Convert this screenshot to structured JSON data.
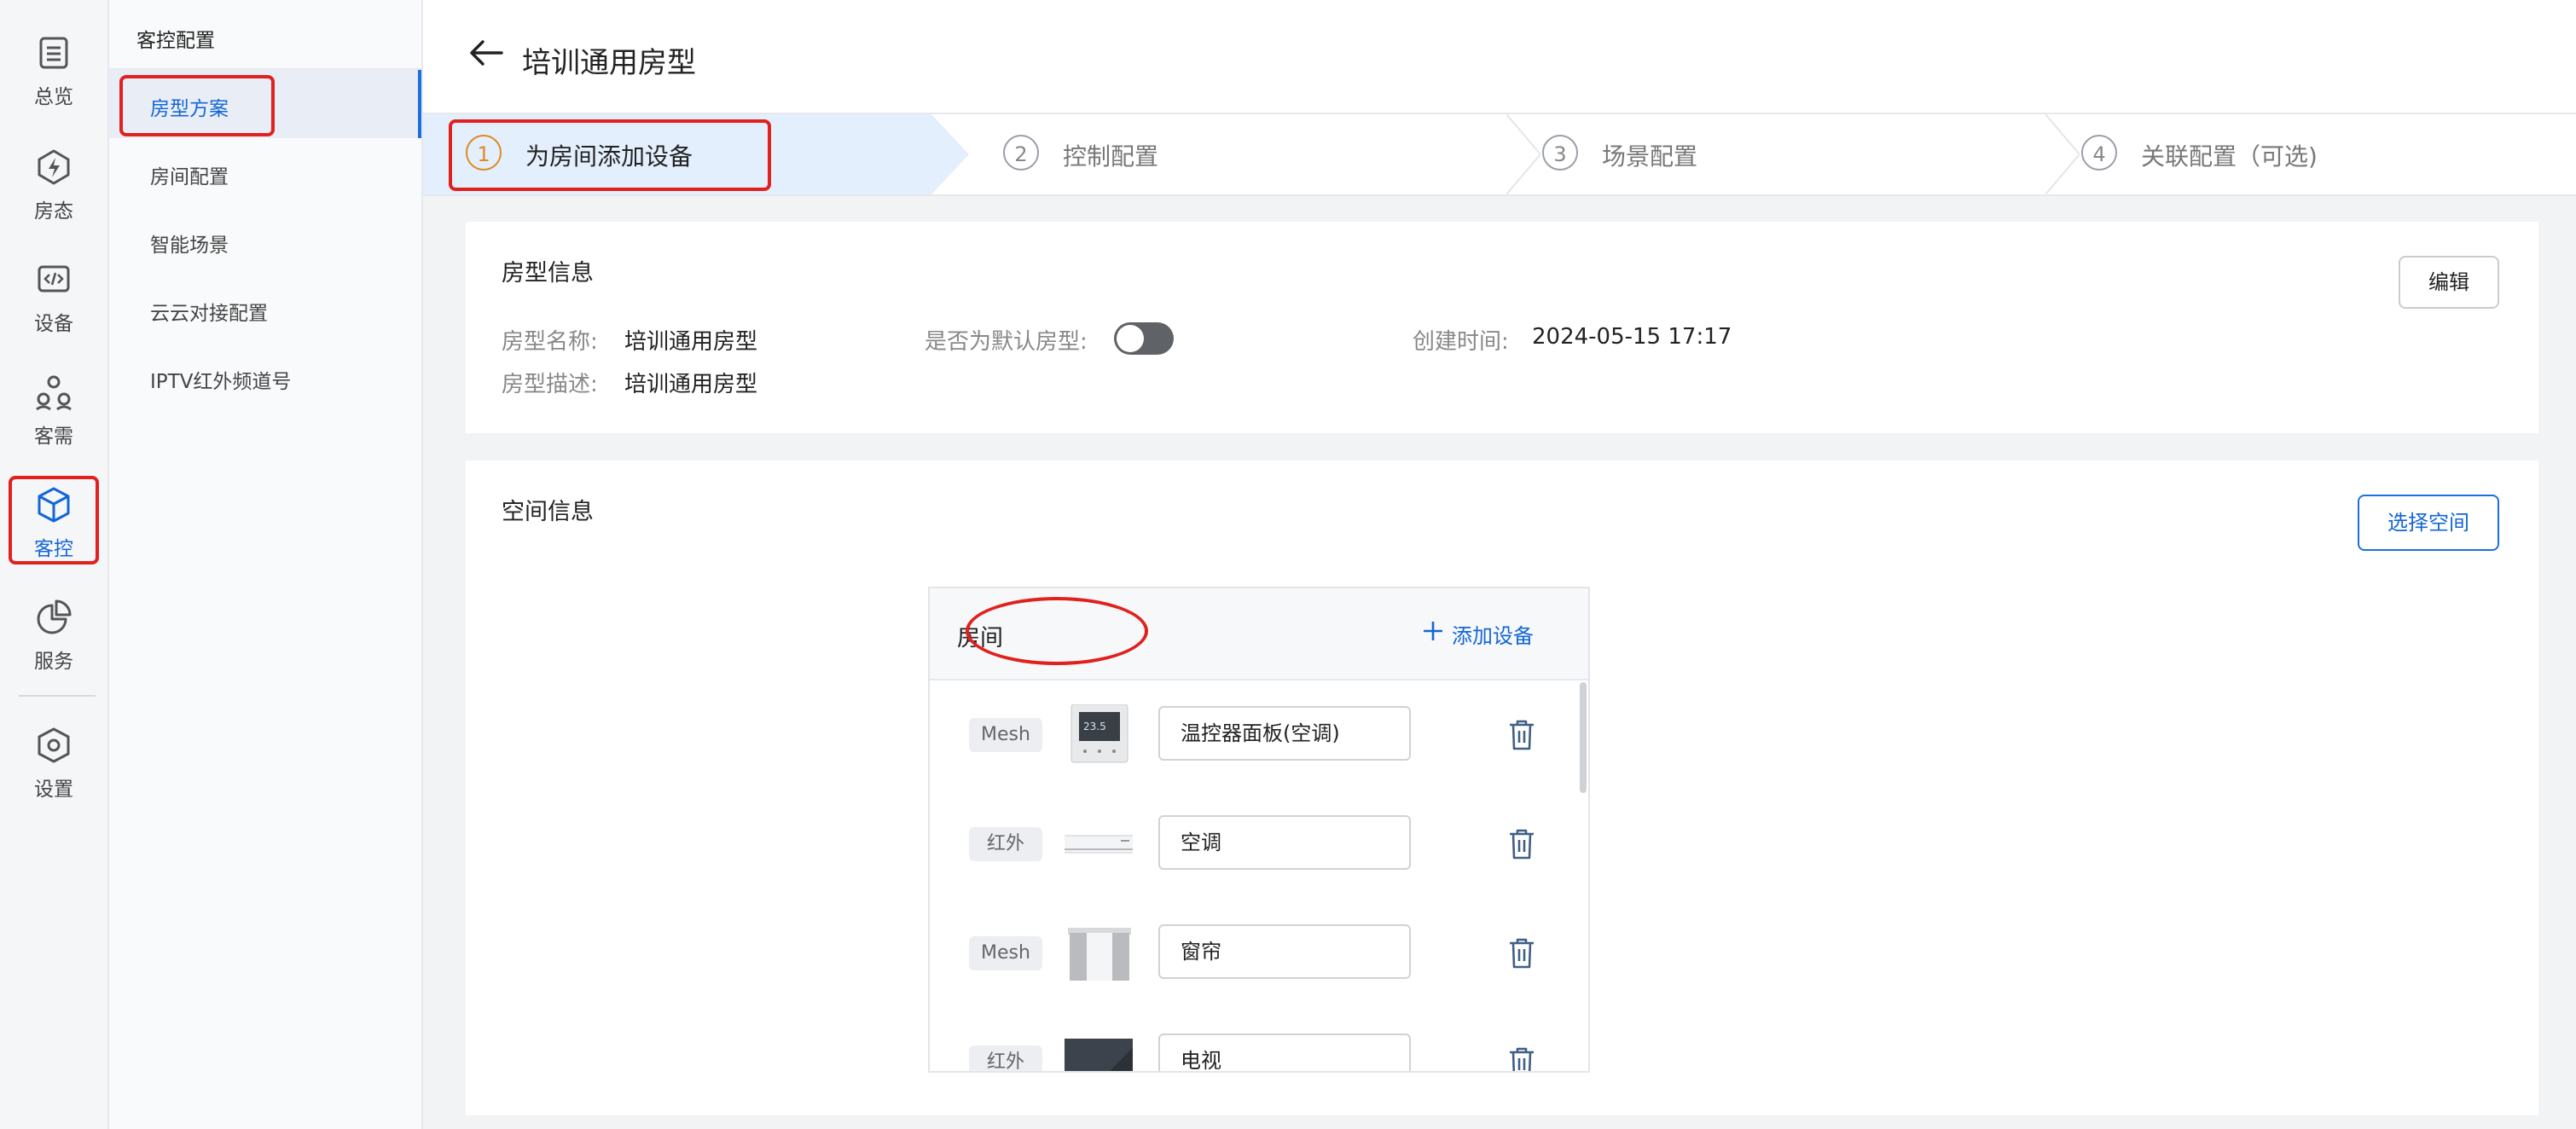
{
  "colors": {
    "accent": "#1366d6",
    "annotation": "#e0211d",
    "step_active": "#e08a1c"
  },
  "rail": {
    "items": [
      {
        "label": "总览",
        "icon": "list-icon"
      },
      {
        "label": "房态",
        "icon": "lightning-icon"
      },
      {
        "label": "设备",
        "icon": "code-icon"
      },
      {
        "label": "客需",
        "icon": "people-icon"
      },
      {
        "label": "客控",
        "icon": "cube-icon"
      },
      {
        "label": "服务",
        "icon": "pie-icon"
      },
      {
        "label": "设置",
        "icon": "settings-icon"
      }
    ],
    "active": "客控"
  },
  "subnav": {
    "title": "客控配置",
    "items": [
      {
        "label": "房型方案"
      },
      {
        "label": "房间配置"
      },
      {
        "label": "智能场景"
      },
      {
        "label": "云云对接配置"
      },
      {
        "label": "IPTV红外频道号"
      }
    ],
    "active": "房型方案"
  },
  "header": {
    "title": "培训通用房型",
    "back_icon": "arrow-left-icon"
  },
  "steps": [
    {
      "num": "1",
      "label": "为房间添加设备",
      "active": true
    },
    {
      "num": "2",
      "label": "控制配置",
      "active": false
    },
    {
      "num": "3",
      "label": "场景配置",
      "active": false
    },
    {
      "num": "4",
      "label": "关联配置（可选)",
      "active": false
    }
  ],
  "room_type_info": {
    "title": "房型信息",
    "edit_button": "编辑",
    "name_label": "房型名称:",
    "name_value": "培训通用房型",
    "default_label": "是否为默认房型:",
    "default_value": "off",
    "created_label": "创建时间:",
    "created_value": "2024-05-15 17:17",
    "desc_label": "房型描述:",
    "desc_value": "培训通用房型"
  },
  "space_info": {
    "title": "空间信息",
    "select_button": "选择空间",
    "room": {
      "name": "房间",
      "add_device": "添加设备",
      "devices": [
        {
          "protocol": "Mesh",
          "name": "温控器面板(空调)",
          "thumb": "thermostat-panel-image"
        },
        {
          "protocol": "红外",
          "name": "空调",
          "thumb": "air-conditioner-image"
        },
        {
          "protocol": "Mesh",
          "name": "窗帘",
          "thumb": "curtain-image"
        },
        {
          "protocol": "红外",
          "name": "电视",
          "thumb": "tv-image"
        }
      ]
    }
  }
}
